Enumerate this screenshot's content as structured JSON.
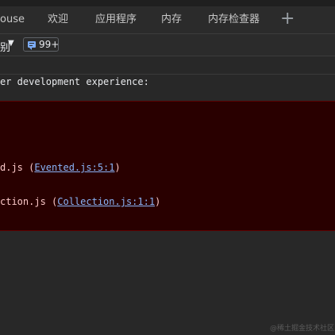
{
  "tabs": [
    {
      "label": "ouse"
    },
    {
      "label": "欢迎"
    },
    {
      "label": "应用程序"
    },
    {
      "label": "内存"
    },
    {
      "label": "内存检查器"
    }
  ],
  "add_tab_label": "+",
  "toolbar": {
    "level_label": "别",
    "level_caret": "▼",
    "issues_count": "99+"
  },
  "console": {
    "message": "er development experience:",
    "trace": [
      {
        "prefix": "d.js (",
        "link": "Evented.js:5:1",
        "suffix": ")"
      },
      {
        "prefix": "ction.js (",
        "link": "Collection.js:1:1",
        "suffix": ")"
      }
    ]
  },
  "watermark": "@稀土掘金技术社区",
  "colors": {
    "error_bg": "#290000",
    "error_border": "#5c0000",
    "link": "#8ab4f8",
    "issues_icon": "#7cacf8"
  }
}
